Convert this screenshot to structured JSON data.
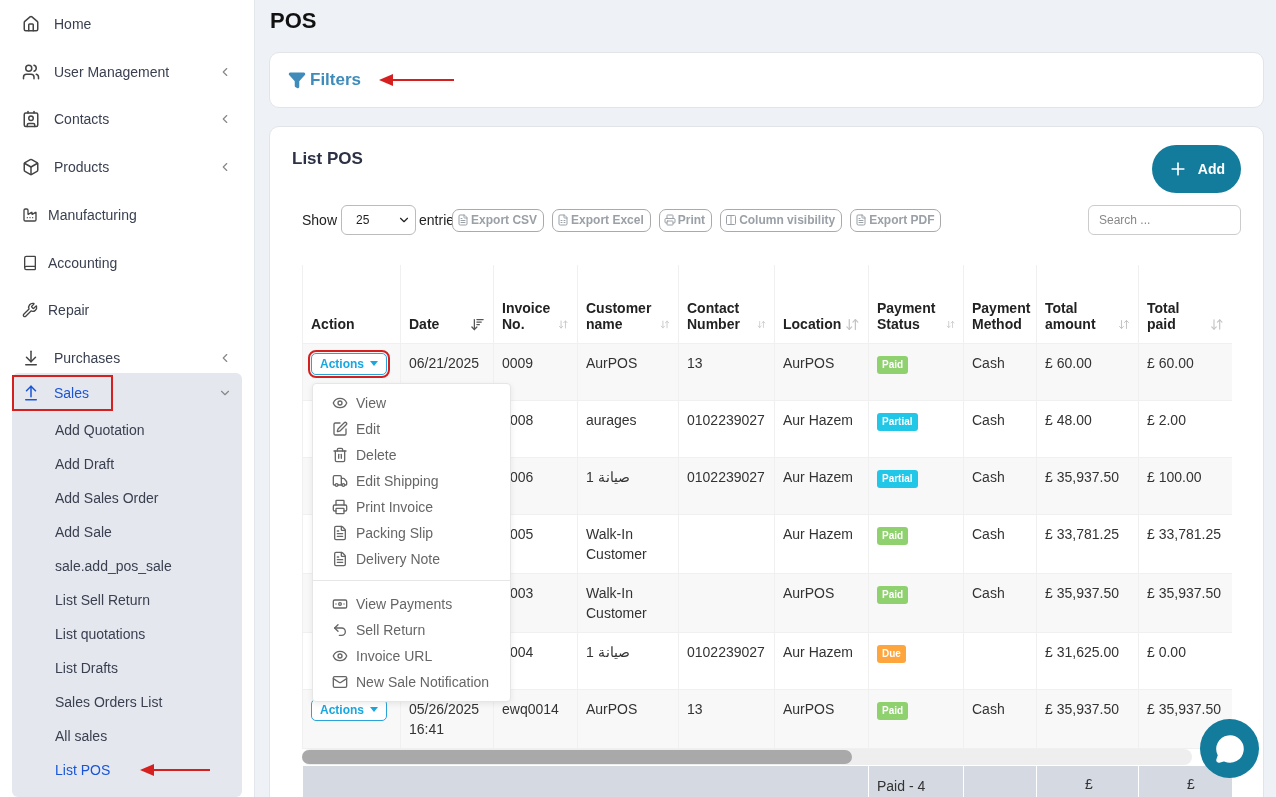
{
  "sidebar": {
    "items": [
      {
        "label": "Home",
        "has_children": false
      },
      {
        "label": "User Management",
        "has_children": true
      },
      {
        "label": "Contacts",
        "has_children": true
      },
      {
        "label": "Products",
        "has_children": true
      },
      {
        "label": "Manufacturing",
        "has_children": false
      },
      {
        "label": "Accounting",
        "has_children": false
      },
      {
        "label": "Repair",
        "has_children": false
      },
      {
        "label": "Purchases",
        "has_children": true
      },
      {
        "label": "Sales",
        "has_children": true,
        "expanded": true,
        "highlighted": true,
        "children": [
          {
            "label": "Add Quotation",
            "selected": false
          },
          {
            "label": "Add Draft",
            "selected": false
          },
          {
            "label": "Add Sales Order",
            "selected": false
          },
          {
            "label": "Add Sale",
            "selected": false
          },
          {
            "label": "sale.add_pos_sale",
            "selected": false
          },
          {
            "label": "List Sell Return",
            "selected": false
          },
          {
            "label": "List quotations",
            "selected": false
          },
          {
            "label": "List Drafts",
            "selected": false
          },
          {
            "label": "Sales Orders List",
            "selected": false
          },
          {
            "label": "All sales",
            "selected": false
          },
          {
            "label": "List POS",
            "selected": true,
            "arrow": true
          }
        ]
      }
    ]
  },
  "page_title": "POS",
  "filters": {
    "label": "Filters",
    "arrow": true
  },
  "list": {
    "title": "List POS",
    "add_button": "Add",
    "show_label": "Show",
    "page_size": "25",
    "entries_label": "entrie",
    "export_buttons": [
      {
        "kind": "file",
        "label": "Export CSV"
      },
      {
        "kind": "excel",
        "label": "Export Excel"
      },
      {
        "kind": "print",
        "label": "Print"
      },
      {
        "kind": "columns",
        "label": "Column visibility"
      },
      {
        "kind": "pdf",
        "label": "Export PDF"
      }
    ],
    "search": {
      "placeholder": "Search ..."
    },
    "table": {
      "columns": [
        {
          "label": "Action"
        },
        {
          "label": "Date",
          "sortable": true,
          "sorted": true
        },
        {
          "label": "Invoice No.",
          "sortable": true,
          "sorted": false
        },
        {
          "label": "Customer name",
          "sortable": true,
          "sorted": false
        },
        {
          "label": "Contact Number",
          "sortable": true,
          "sorted": false
        },
        {
          "label": "Location",
          "sortable": true,
          "sorted": false
        },
        {
          "label": "Payment Status",
          "sortable": true,
          "sorted": false
        },
        {
          "label": "Payment Method"
        },
        {
          "label": "Total amount",
          "sortable": true,
          "sorted": false
        },
        {
          "label": "Total paid",
          "sortable": true,
          "sorted": false
        }
      ],
      "rows": [
        {
          "action": "Actions",
          "highlighted": true,
          "date": [
            "06/21/2025"
          ],
          "invoice": "0009",
          "customer": "AurPOS",
          "contact": "13",
          "location": "AurPOS",
          "status": {
            "label": "Paid",
            "color": "#8fd16f"
          },
          "method": "Cash",
          "total": "£ 60.00",
          "paid": "£ 60.00"
        },
        {
          "invoice": "008",
          "customer": "aurages",
          "contact": "0102239027",
          "location": "Aur Hazem",
          "status": {
            "label": "Partial",
            "color": "#22c7e8"
          },
          "method": "Cash",
          "total": "£ 48.00",
          "paid": "£ 2.00"
        },
        {
          "invoice": "006",
          "customer": "صيانة 1",
          "contact": "0102239027",
          "location": "Aur Hazem",
          "status": {
            "label": "Partial",
            "color": "#22c7e8"
          },
          "method": "Cash",
          "total": "£ 35,937.50",
          "paid": "£ 100.00"
        },
        {
          "invoice": "005",
          "customer": "Walk-In Customer",
          "location": "Aur Hazem",
          "status": {
            "label": "Paid",
            "color": "#8fd16f"
          },
          "method": "Cash",
          "total": "£ 33,781.25",
          "paid": "£ 33,781.25"
        },
        {
          "invoice": "003",
          "customer": "Walk-In Customer",
          "location": "AurPOS",
          "status": {
            "label": "Paid",
            "color": "#8fd16f"
          },
          "method": "Cash",
          "total": "£ 35,937.50",
          "paid": "£ 35,937.50"
        },
        {
          "invoice": "004",
          "customer": "صيانة 1",
          "contact": "0102239027",
          "location": "Aur Hazem",
          "status": {
            "label": "Due",
            "color": "#ffa53d"
          },
          "total": "£ 31,625.00",
          "paid": "£ 0.00"
        },
        {
          "action": "Actions",
          "date": [
            "05/26/2025",
            "16:41"
          ],
          "invoice": "ewq0014",
          "customer": "AurPOS",
          "contact": "13",
          "location": "AurPOS",
          "status": {
            "label": "Paid",
            "color": "#8fd16f"
          },
          "method": "Cash",
          "total": "£ 35,937.50",
          "paid": "£ 35,937.50"
        }
      ],
      "footer": {
        "status_summary": "Paid - 4",
        "total": "£",
        "paid": "£"
      }
    },
    "action_menu": {
      "groups": [
        [
          {
            "kind": "view",
            "label": "View"
          },
          {
            "kind": "edit",
            "label": "Edit"
          },
          {
            "kind": "delete",
            "label": "Delete"
          },
          {
            "kind": "shipping",
            "label": "Edit Shipping"
          },
          {
            "kind": "print",
            "label": "Print Invoice"
          },
          {
            "kind": "file",
            "label": "Packing Slip"
          },
          {
            "kind": "file",
            "label": "Delivery Note"
          }
        ],
        [
          {
            "kind": "money",
            "label": "View Payments"
          },
          {
            "kind": "undo",
            "label": "Sell Return"
          },
          {
            "kind": "view",
            "label": "Invoice URL"
          },
          {
            "kind": "mail",
            "label": "New Sale Notification"
          }
        ]
      ]
    }
  }
}
